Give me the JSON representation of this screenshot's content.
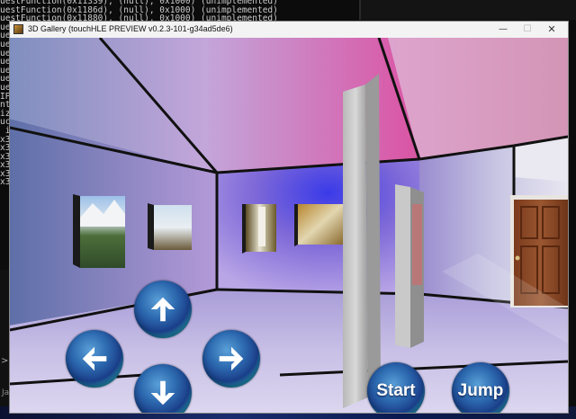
{
  "terminal": {
    "lines": [
      "uestFunction(0x11339), (null), 0x1000) (unimplemented)",
      "uestFunction(0x1186d), (null), 0x1000) (unimplemented)",
      "uestFunction(0x11880), (null), 0x1000) (unimplemented)",
      "ue",
      "ue",
      "ue",
      "ue",
      "ue",
      "ue",
      "ue",
      "ue",
      "IP",
      "",
      "nt",
      "",
      "iz",
      "uc",
      "",
      " i",
      "",
      "",
      "x3",
      "x3",
      "x3",
      "x3",
      "x3",
      "x3"
    ],
    "gutter_text": "Ja",
    "gutter_chevron": ">"
  },
  "window": {
    "title": "3D Gallery (touchHLE PREVIEW v0.2.3-101-g34ad5de6)",
    "minimize_glyph": "—",
    "maximize_glyph": "☐",
    "close_glyph": "✕"
  },
  "controls": {
    "start_label": "Start",
    "jump_label": "Jump"
  },
  "icons": {
    "up": "arrow-up-icon",
    "down": "arrow-down-icon",
    "left": "arrow-left-icon",
    "right": "arrow-right-icon",
    "app": "app-icon"
  },
  "colors": {
    "wall_purple": "#6c5fd0",
    "ceiling_pink": "#d8a0e0",
    "floor_lavender": "#c7bde0",
    "door_brown": "#8a4a26",
    "button_blue": "#2d6ab0",
    "button_rim_teal": "#3cc6c6"
  }
}
